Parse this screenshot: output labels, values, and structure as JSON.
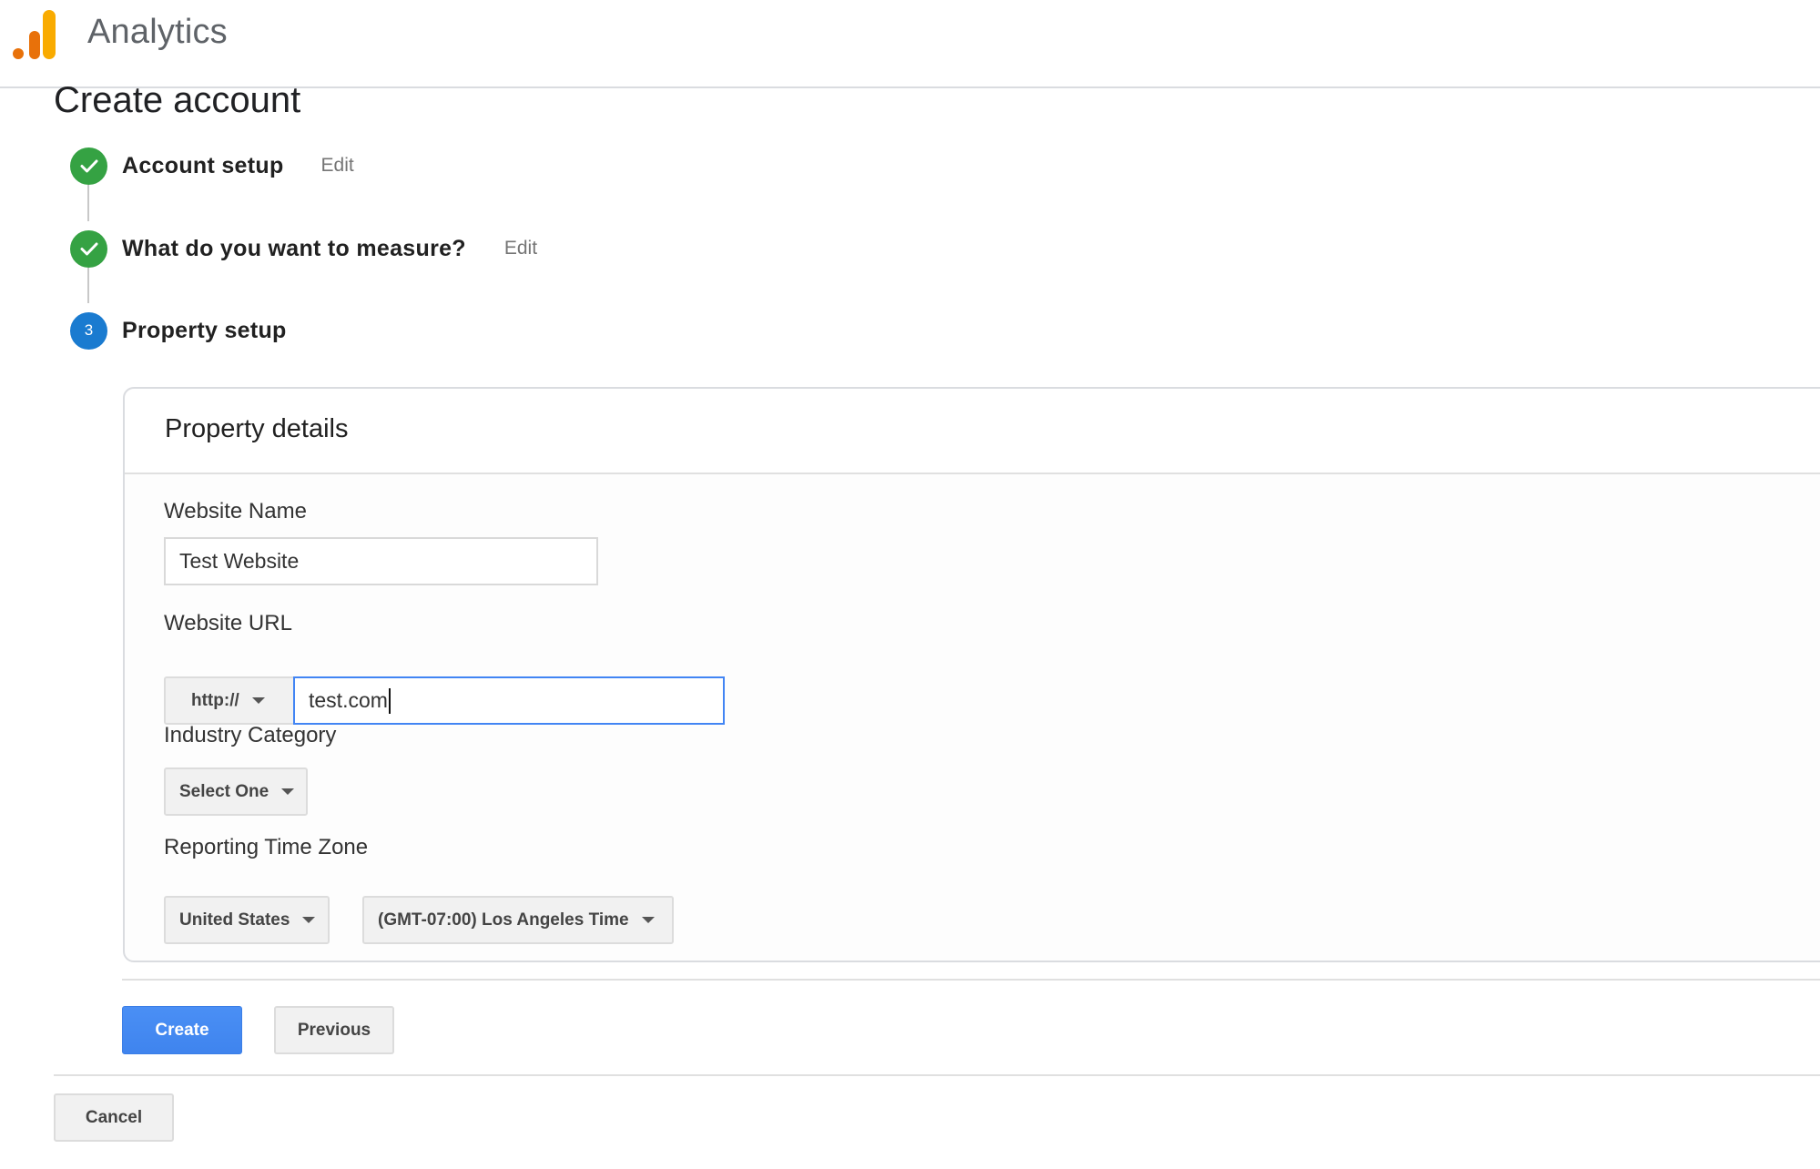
{
  "header": {
    "app_name": "Analytics",
    "logo_icon": "analytics-bars-logo",
    "logo_colors": {
      "primary": "#f9ab00",
      "secondary": "#e8710a"
    }
  },
  "page": {
    "title": "Create account"
  },
  "stepper": {
    "steps": [
      {
        "label": "Account setup",
        "status": "complete",
        "icon": "check-icon",
        "edit_label": "Edit"
      },
      {
        "label": "What do you want to measure?",
        "status": "complete",
        "icon": "check-icon",
        "edit_label": "Edit"
      },
      {
        "label": "Property setup",
        "status": "active",
        "number": "3"
      }
    ],
    "colors": {
      "complete": "#35a243",
      "active": "#1a7bd0"
    }
  },
  "property_details": {
    "title": "Property details",
    "website_name": {
      "label": "Website Name",
      "value": "Test Website"
    },
    "website_url": {
      "label": "Website URL",
      "protocol": "http://",
      "value": "test.com"
    },
    "industry_category": {
      "label": "Industry Category",
      "selected": "Select One"
    },
    "time_zone": {
      "label": "Reporting Time Zone",
      "country": "United States",
      "zone": "(GMT-07:00) Los Angeles Time"
    }
  },
  "actions": {
    "create_label": "Create",
    "previous_label": "Previous",
    "cancel_label": "Cancel",
    "primary_color": "#4285f4"
  }
}
